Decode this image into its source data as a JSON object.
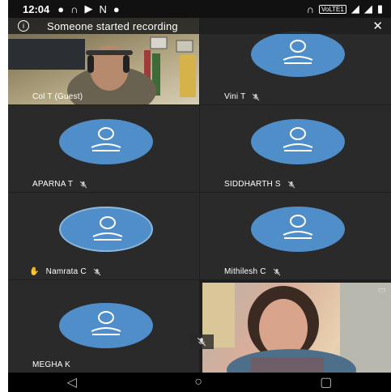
{
  "status_bar": {
    "time": "12:04",
    "network_label": "VoLTE1"
  },
  "banner": {
    "message": "Someone started recording"
  },
  "participants": [
    {
      "name": "Col T (Guest)",
      "muted": false,
      "video": true
    },
    {
      "name": "Vini T",
      "muted": true,
      "video": false
    },
    {
      "name": "APARNA T",
      "muted": true,
      "video": false
    },
    {
      "name": "SIDDHARTH S",
      "muted": true,
      "video": false
    },
    {
      "name": "Namrata C",
      "muted": true,
      "video": false,
      "hand_raised": true
    },
    {
      "name": "Mithilesh C",
      "muted": true,
      "video": false
    },
    {
      "name": "MEGHA K",
      "muted": false,
      "video": false
    },
    {
      "name": "",
      "muted": true,
      "video": true,
      "self_view": true
    }
  ],
  "colors": {
    "avatar": "#4f8ec9",
    "tile_bg": "#2a2a2a",
    "banner_bg": "#1e1e1e"
  },
  "icons": [
    "info-icon",
    "close-icon",
    "mic-off-icon",
    "raised-hand-icon",
    "camera-switch-icon",
    "back-nav-icon",
    "home-nav-icon",
    "recents-nav-icon"
  ]
}
